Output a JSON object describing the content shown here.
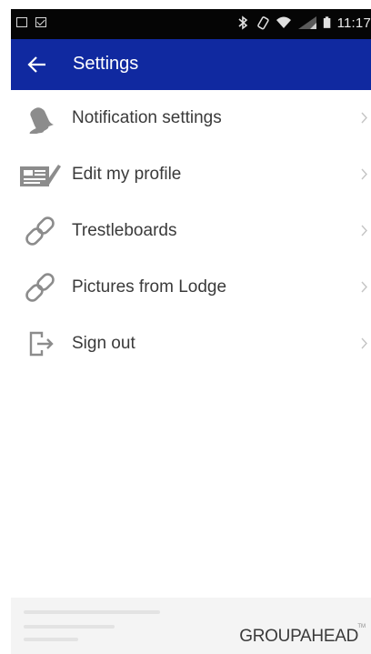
{
  "status_bar": {
    "time": "11:17",
    "icons": [
      "picture-icon",
      "mail-icon",
      "bluetooth-icon",
      "rotate-icon",
      "wifi-icon",
      "signal-icon",
      "battery-icon"
    ]
  },
  "app_bar": {
    "title": "Settings",
    "back_icon": "arrow-left-icon"
  },
  "menu": {
    "items": [
      {
        "label": "Notification settings",
        "icon": "bell-icon"
      },
      {
        "label": "Edit my profile",
        "icon": "id-card-icon"
      },
      {
        "label": "Trestleboards",
        "icon": "link-icon"
      },
      {
        "label": "Pictures from Lodge",
        "icon": "link-icon"
      },
      {
        "label": "Sign out",
        "icon": "sign-out-icon"
      }
    ]
  },
  "footer": {
    "brand": "GROUPAHEAD",
    "trademark": "TM"
  },
  "colors": {
    "app_bar": "#1029a0",
    "status_bar": "#050505",
    "icon_gray": "#8c8c8c",
    "text": "#3a3a3a"
  }
}
